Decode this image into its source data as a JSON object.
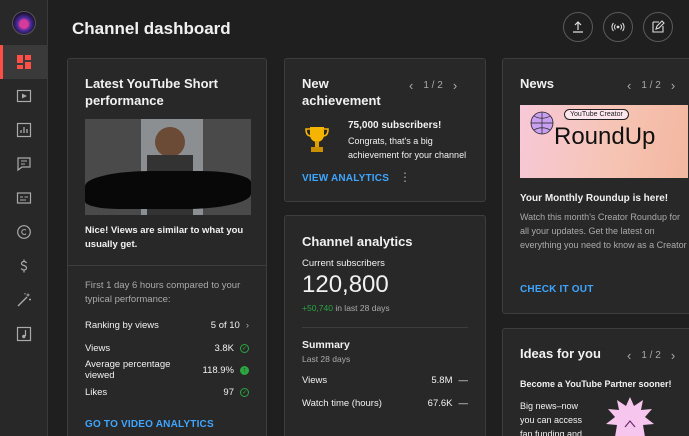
{
  "header": {
    "title": "Channel dashboard"
  },
  "rail": {
    "items": [
      "dashboard-icon",
      "content-icon",
      "analytics-icon",
      "comments-icon",
      "subtitles-icon",
      "copyright-icon",
      "earn-icon",
      "customization-icon",
      "audio-library-icon"
    ]
  },
  "short_card": {
    "title": "Latest YouTube Short performance",
    "message": "Nice! Views are similar to what you usually get.",
    "comparison": "First 1 day 6 hours compared to your typical performance:",
    "ranking_label": "Ranking by views",
    "ranking_value": "5 of 10",
    "stats": [
      {
        "label": "Views",
        "value": "3.8K"
      },
      {
        "label": "Average percentage viewed",
        "value": "118.9%"
      },
      {
        "label": "Likes",
        "value": "97"
      }
    ],
    "link": "GO TO VIDEO ANALYTICS"
  },
  "achievement": {
    "title": "New achievement",
    "page": "1 / 2",
    "headline": "75,000 subscribers!",
    "body": "Congrats, that's a big achievement for your channel",
    "link": "VIEW ANALYTICS"
  },
  "analytics": {
    "title": "Channel analytics",
    "subs_label": "Current subscribers",
    "subs_value": "120,800",
    "delta": "+50,740",
    "delta_suffix": " in last 28 days",
    "summary_title": "Summary",
    "summary_sub": "Last 28 days",
    "rows": [
      {
        "label": "Views",
        "value": "5.8M",
        "trend": "—"
      },
      {
        "label": "Watch time (hours)",
        "value": "67.6K",
        "trend": "—"
      }
    ]
  },
  "news": {
    "title": "News",
    "page": "1 / 2",
    "banner_tag": "YouTube Creator",
    "banner_text": "RoundUp",
    "headline": "Your Monthly Roundup is here!",
    "body": "Watch this month's Creator Roundup for all your updates. Get the latest on everything you need to know as a Creator",
    "link": "CHECK IT OUT"
  },
  "ideas": {
    "title": "Ideas for you",
    "page": "1 / 2",
    "headline": "Become a YouTube Partner sooner!",
    "body_lines": [
      "Big news–now",
      "you can access",
      "fan funding and"
    ]
  },
  "colors": {
    "accent": "#3ea6ff",
    "active": "#ff4e45",
    "positive": "#2ba640"
  }
}
